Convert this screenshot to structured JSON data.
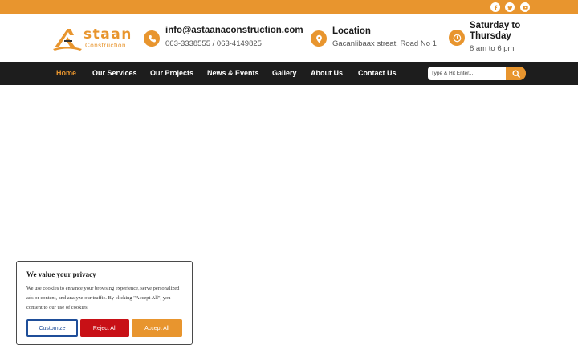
{
  "top_bar": {
    "color": "#e8952e",
    "social_icons": [
      "facebook-icon",
      "twitter-icon",
      "youtube-icon"
    ]
  },
  "logo": {
    "name": "staan",
    "subtitle": "Construction"
  },
  "contact": {
    "email": "info@astaanaconstruction.com",
    "phones": "063-3338555 / 063-4149825"
  },
  "location": {
    "title": "Location",
    "address": "Gacanlibaax streat, Road No 1"
  },
  "hours": {
    "title_line1": "Saturday to",
    "title_line2": "Thursday",
    "time": "8 am to 6 pm"
  },
  "nav": {
    "items": [
      {
        "label": "Home",
        "active": true
      },
      {
        "label": "Our Services",
        "active": false
      },
      {
        "label": "Our Projects",
        "active": false
      },
      {
        "label": "News & Events",
        "active": false
      },
      {
        "label": "Gallery",
        "active": false
      },
      {
        "label": "About Us",
        "active": false
      },
      {
        "label": "Contact Us",
        "active": false
      }
    ],
    "search_placeholder": "Type & Hit Enter..."
  },
  "cookie_banner": {
    "title": "We value your privacy",
    "text": "We use cookies to enhance your browsing experience, serve personalized ads or content, and analyze our traffic. By clicking \"Accept All\", you consent to our use of cookies.",
    "customize_label": "Customize",
    "reject_label": "Reject All",
    "accept_label": "Accept All"
  },
  "colors": {
    "accent": "#e8952e",
    "nav_bg": "#1d1d1d",
    "reject": "#c81016",
    "customize_border": "#1f4e99"
  }
}
